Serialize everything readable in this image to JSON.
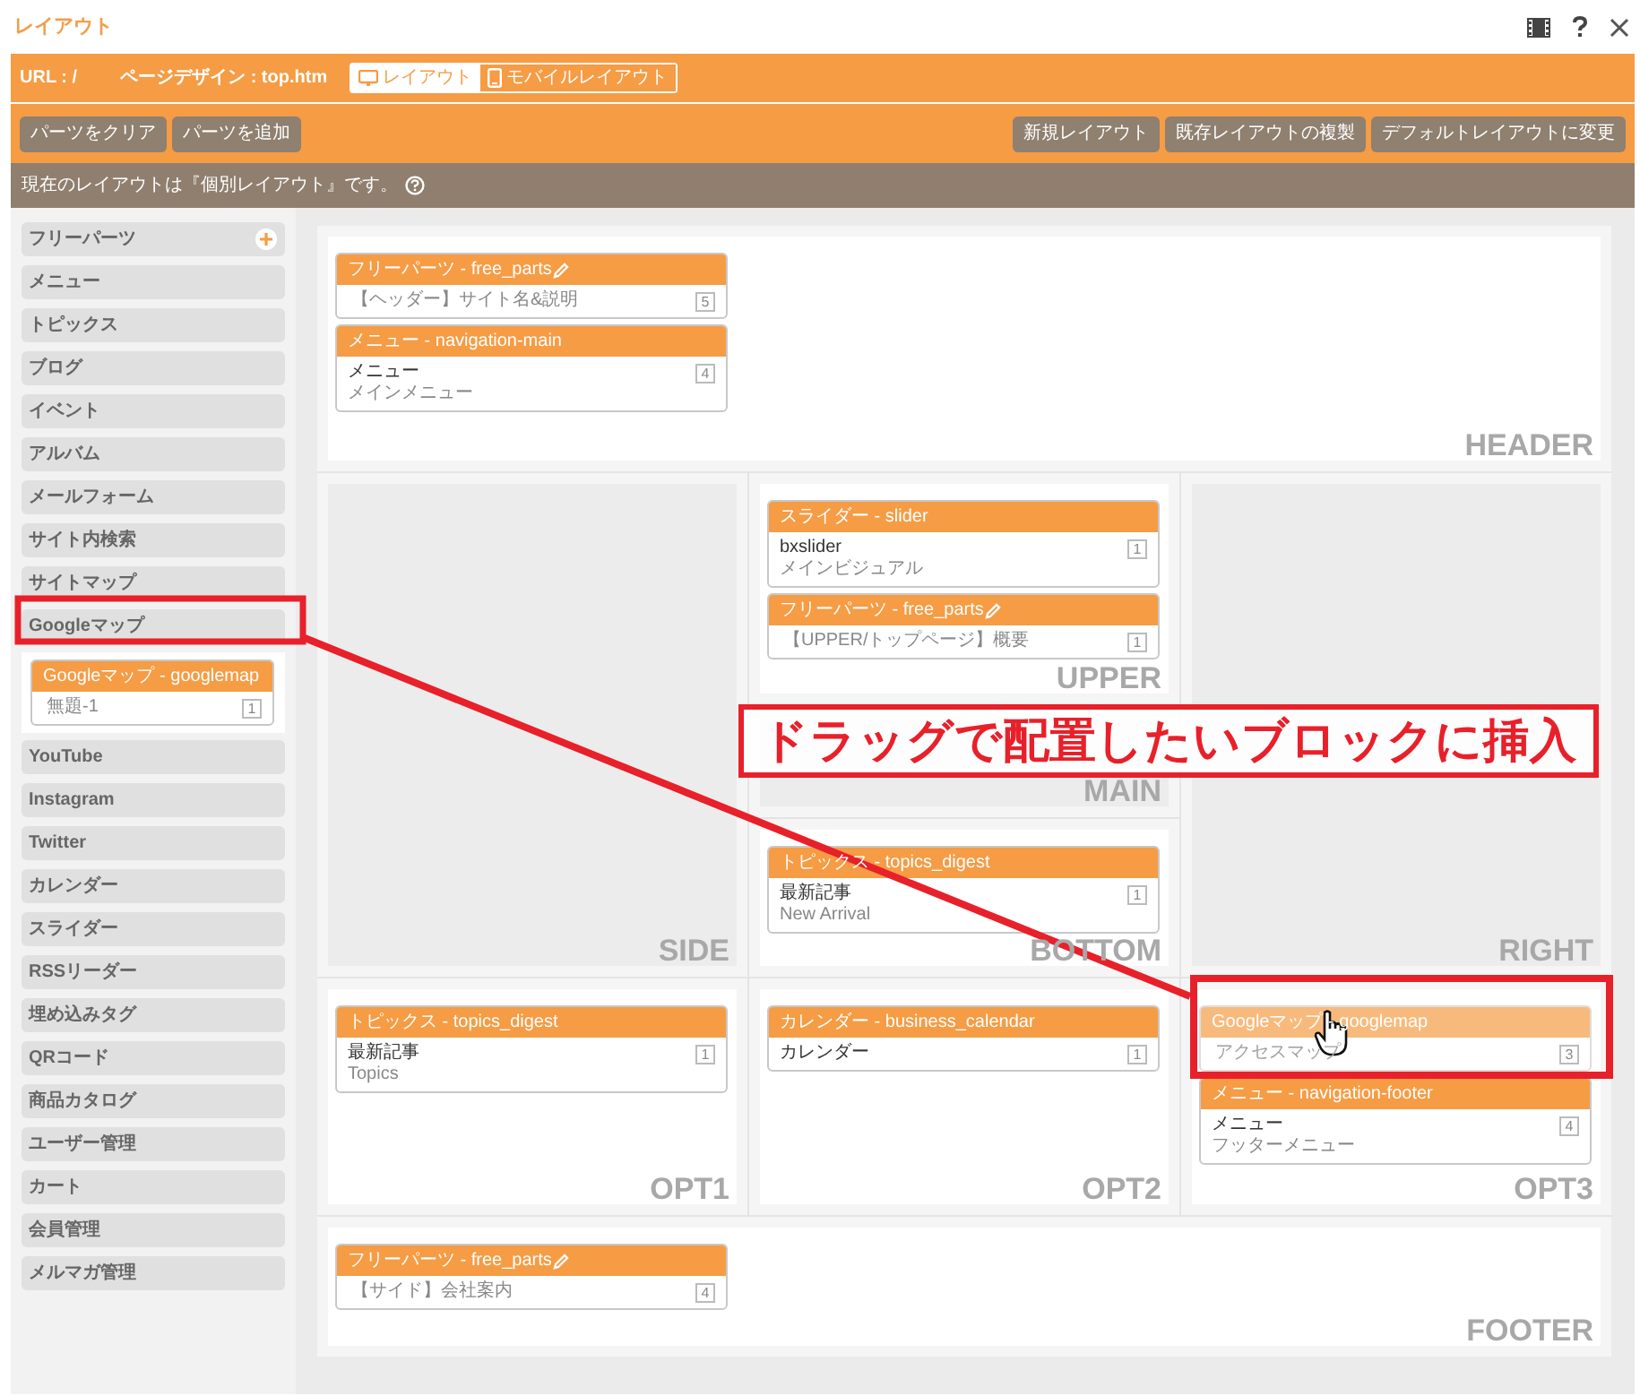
{
  "window": {
    "title": "レイアウト"
  },
  "info_bar": {
    "url": "URL : /",
    "design": "ページデザイン : top.htm"
  },
  "tabs": [
    {
      "label": "レイアウト",
      "selected": true
    },
    {
      "label": "モバイルレイアウト",
      "selected": false
    }
  ],
  "left_buttons": [
    "パーツをクリア",
    "パーツを追加"
  ],
  "right_buttons": [
    "新規レイアウト",
    "既存レイアウトの複製",
    "デフォルトレイアウトに変更"
  ],
  "notice": "現在のレイアウトは『個別レイアウト』です。",
  "sidebar": {
    "items": [
      {
        "label": "フリーパーツ",
        "add_button": true
      },
      {
        "label": "メニュー",
        "add_button": false
      },
      {
        "label": "トピックス",
        "add_button": false
      },
      {
        "label": "ブログ",
        "add_button": false
      },
      {
        "label": "イベント",
        "add_button": false
      },
      {
        "label": "アルバム",
        "add_button": false
      },
      {
        "label": "メールフォーム",
        "add_button": false
      },
      {
        "label": "サイト内検索",
        "add_button": false
      },
      {
        "label": "サイトマップ",
        "add_button": false
      },
      {
        "label": "Googleマップ",
        "add_button": false,
        "cards": [
          {
            "header": "Googleマップ - googlemap",
            "editable": false,
            "dragging": false,
            "subtitle": "無題-1",
            "count": "1"
          }
        ]
      },
      {
        "label": "YouTube",
        "add_button": false
      },
      {
        "label": "Instagram",
        "add_button": false
      },
      {
        "label": "Twitter",
        "add_button": false
      },
      {
        "label": "カレンダー",
        "add_button": false
      },
      {
        "label": "スライダー",
        "add_button": false
      },
      {
        "label": "RSSリーダー",
        "add_button": false
      },
      {
        "label": "埋め込みタグ",
        "add_button": false
      },
      {
        "label": "QRコード",
        "add_button": false
      },
      {
        "label": "商品カタログ",
        "add_button": false
      },
      {
        "label": "ユーザー管理",
        "add_button": false
      },
      {
        "label": "カート",
        "add_button": false
      },
      {
        "label": "会員管理",
        "add_button": false
      },
      {
        "label": "メルマガ管理",
        "add_button": false
      }
    ]
  },
  "regions": [
    {
      "label": "HEADER",
      "cards": [
        {
          "header": "フリーパーツ - free_parts",
          "editable": true,
          "dragging": false,
          "subtitle": "【ヘッダー】サイト名&説明",
          "count": "5"
        },
        {
          "header": "メニュー - navigation-main",
          "editable": false,
          "dragging": false,
          "title": "メニュー",
          "subtitle": "メインメニュー",
          "count": "4"
        }
      ]
    },
    {
      "label": "SIDE"
    },
    {
      "label": "UPPER",
      "cards": [
        {
          "header": "スライダー - slider",
          "editable": false,
          "dragging": false,
          "title": "bxslider",
          "subtitle": "メインビジュアル",
          "count": "1"
        },
        {
          "header": "フリーパーツ - free_parts",
          "editable": true,
          "dragging": false,
          "subtitle": "【UPPER/トップページ】概要",
          "count": "1"
        }
      ]
    },
    {
      "label": "MAIN"
    },
    {
      "label": "BOTTOM",
      "cards": [
        {
          "header": "トピックス - topics_digest",
          "editable": false,
          "dragging": false,
          "title": "最新記事",
          "subtitle": "New Arrival",
          "count": "1"
        }
      ]
    },
    {
      "label": "RIGHT"
    },
    {
      "label": "OPT1",
      "cards": [
        {
          "header": "トピックス - topics_digest",
          "editable": false,
          "dragging": false,
          "title": "最新記事",
          "subtitle": "Topics",
          "count": "1"
        }
      ]
    },
    {
      "label": "OPT2",
      "cards": [
        {
          "header": "カレンダー - business_calendar",
          "editable": false,
          "dragging": false,
          "title": "カレンダー",
          "count": "1"
        }
      ]
    },
    {
      "label": "OPT3",
      "cards": [
        {
          "header": "Googleマップ - googlemap",
          "editable": false,
          "dragging": true,
          "subtitle": "アクセスマップ",
          "count": "3"
        },
        {
          "header": "メニュー - navigation-footer",
          "editable": false,
          "dragging": false,
          "title": "メニュー",
          "subtitle": "フッターメニュー",
          "count": "4"
        }
      ]
    },
    {
      "label": "FOOTER",
      "cards": [
        {
          "header": "フリーパーツ - free_parts",
          "editable": true,
          "dragging": false,
          "subtitle": "【サイド】会社案内",
          "count": "4"
        }
      ]
    }
  ],
  "callout": "ドラッグで配置したいブロックに挿入"
}
